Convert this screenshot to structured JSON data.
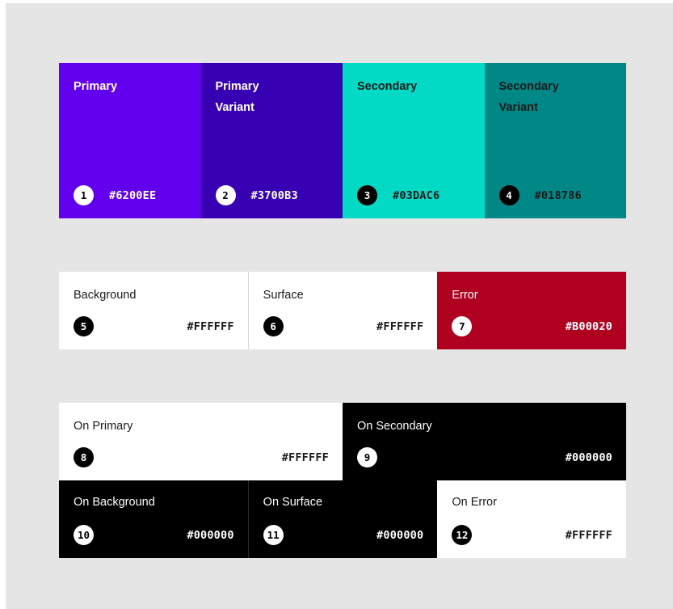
{
  "palette": {
    "rows": [
      [
        {
          "name": "Primary",
          "number": "1",
          "hex": "#6200EE",
          "bg": "#6200EE",
          "text_color": "#FFFFFF",
          "badge_bg": "#FFFFFF",
          "badge_fg": "#000000"
        },
        {
          "name": "Primary\nVariant",
          "number": "2",
          "hex": "#3700B3",
          "bg": "#3700B3",
          "text_color": "#FFFFFF",
          "badge_bg": "#FFFFFF",
          "badge_fg": "#000000"
        },
        {
          "name": "Secondary",
          "number": "3",
          "hex": "#03DAC6",
          "bg": "#03DAC6",
          "text_color": "#1A1A1A",
          "badge_bg": "#000000",
          "badge_fg": "#FFFFFF"
        },
        {
          "name": "Secondary\nVariant",
          "number": "4",
          "hex": "#018786",
          "bg": "#018786",
          "text_color": "#1A1A1A",
          "badge_bg": "#000000",
          "badge_fg": "#FFFFFF"
        }
      ],
      [
        {
          "name": "Background",
          "number": "5",
          "hex": "#FFFFFF",
          "bg": "#FFFFFF",
          "text_color": "#1A1A1A",
          "badge_bg": "#000000",
          "badge_fg": "#FFFFFF"
        },
        {
          "name": "Surface",
          "number": "6",
          "hex": "#FFFFFF",
          "bg": "#FFFFFF",
          "text_color": "#1A1A1A",
          "badge_bg": "#000000",
          "badge_fg": "#FFFFFF"
        },
        {
          "name": "Error",
          "number": "7",
          "hex": "#B00020",
          "bg": "#B00020",
          "text_color": "#FFFFFF",
          "badge_bg": "#FFFFFF",
          "badge_fg": "#000000"
        }
      ],
      [
        {
          "name": "On Primary",
          "number": "8",
          "hex": "#FFFFFF",
          "bg": "#FFFFFF",
          "text_color": "#1A1A1A",
          "badge_bg": "#000000",
          "badge_fg": "#FFFFFF"
        },
        {
          "name": "On Secondary",
          "number": "9",
          "hex": "#000000",
          "bg": "#000000",
          "text_color": "#FFFFFF",
          "badge_bg": "#FFFFFF",
          "badge_fg": "#000000"
        }
      ],
      [
        {
          "name": "On Background",
          "number": "10",
          "hex": "#000000",
          "bg": "#000000",
          "text_color": "#FFFFFF",
          "badge_bg": "#FFFFFF",
          "badge_fg": "#000000"
        },
        {
          "name": "On Surface",
          "number": "11",
          "hex": "#000000",
          "bg": "#000000",
          "text_color": "#FFFFFF",
          "badge_bg": "#FFFFFF",
          "badge_fg": "#000000"
        },
        {
          "name": "On Error",
          "number": "12",
          "hex": "#FFFFFF",
          "bg": "#FFFFFF",
          "text_color": "#1A1A1A",
          "badge_bg": "#000000",
          "badge_fg": "#FFFFFF"
        }
      ]
    ]
  }
}
